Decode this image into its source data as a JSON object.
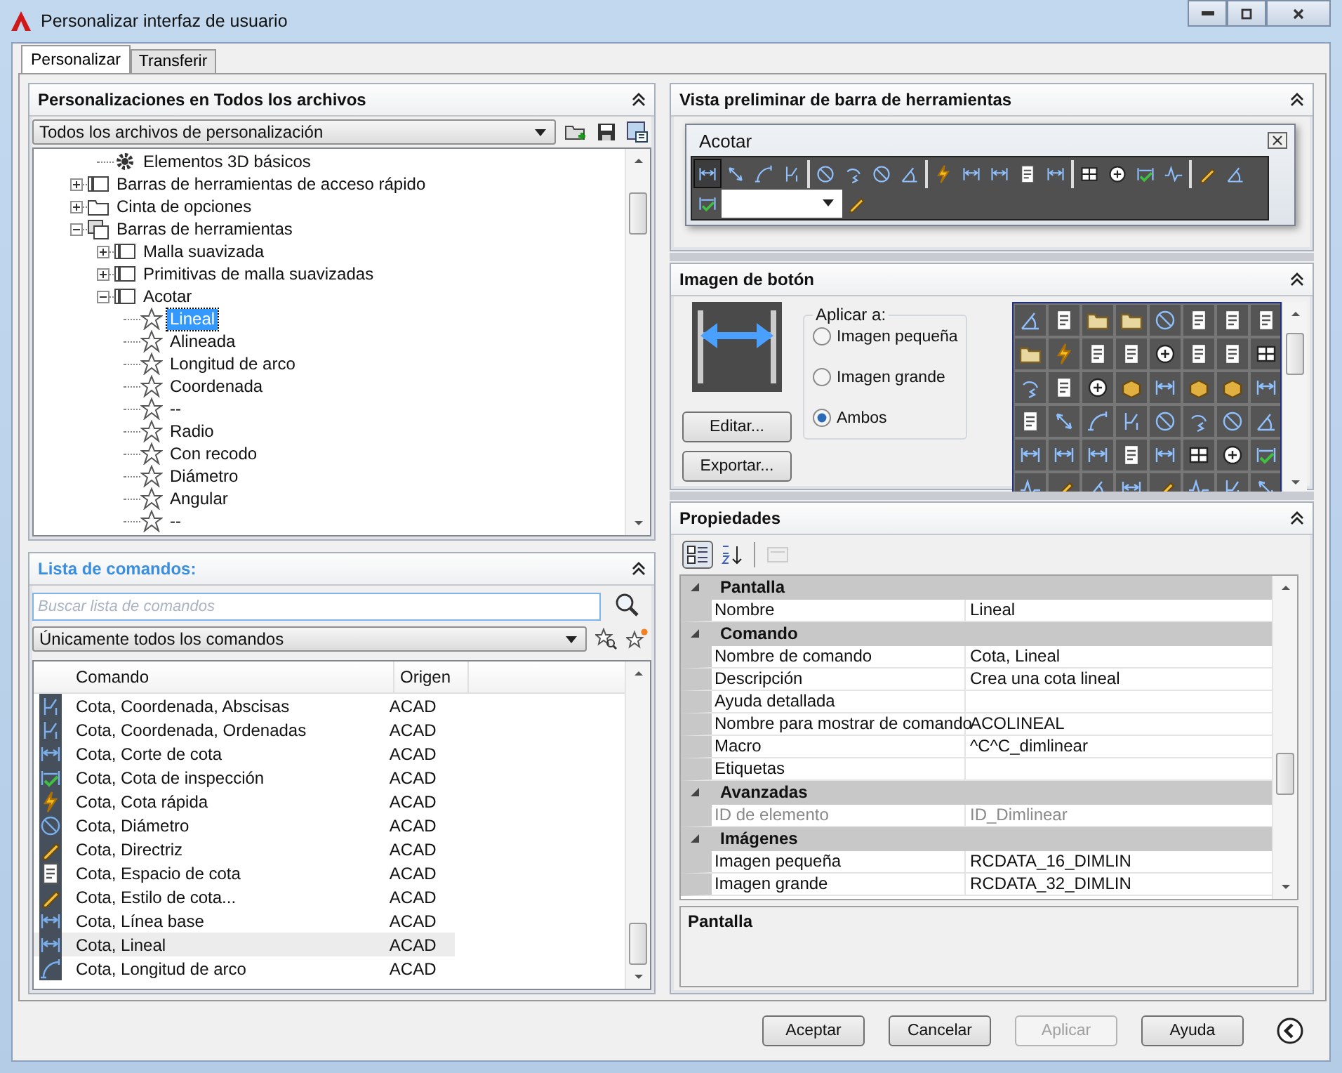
{
  "window": {
    "title": "Personalizar interfaz de usuario"
  },
  "tabs": [
    {
      "label": "Personalizar",
      "selected": true
    },
    {
      "label": "Transferir",
      "selected": false
    }
  ],
  "customizations": {
    "title": "Personalizaciones en Todos los archivos",
    "file_select": "Todos los archivos de personalización",
    "tree": [
      {
        "children": [
          {
            "label": "Elementos 3D básicos",
            "kind": "element",
            "selected": false
          }
        ]
      },
      {
        "label": "Barras de herramientas de acceso rápido",
        "kind": "quick-access",
        "expanded": false,
        "selected": false
      },
      {
        "label": "Cinta de opciones",
        "kind": "ribbon",
        "expanded": false,
        "selected": false
      },
      {
        "label": "Barras de herramientas",
        "kind": "toolbar-group",
        "expanded": true,
        "selected": false,
        "children": [
          {
            "label": "Malla suavizada",
            "kind": "toolbar",
            "expanded": false,
            "selected": false
          },
          {
            "label": "Primitivas de malla suavizadas",
            "kind": "toolbar",
            "expanded": false,
            "selected": false
          },
          {
            "label": "Acotar",
            "kind": "toolbar",
            "expanded": true,
            "selected": false,
            "children": [
              {
                "label": "Lineal",
                "kind": "command",
                "selected": true
              },
              {
                "label": "Alineada",
                "kind": "command",
                "selected": false
              },
              {
                "label": "Longitud de arco",
                "kind": "command",
                "selected": false
              },
              {
                "label": "Coordenada",
                "kind": "command",
                "selected": false
              },
              {
                "label": "--",
                "kind": "command",
                "selected": false
              },
              {
                "label": "Radio",
                "kind": "command",
                "selected": false
              },
              {
                "label": "Con recodo",
                "kind": "command",
                "selected": false
              },
              {
                "label": "Diámetro",
                "kind": "command",
                "selected": false
              },
              {
                "label": "Angular",
                "kind": "command",
                "selected": false
              },
              {
                "label": "--",
                "kind": "command",
                "selected": false
              }
            ]
          }
        ]
      }
    ]
  },
  "command_list": {
    "title": "Lista de comandos:",
    "search": {
      "placeholder": "Buscar lista de comandos"
    },
    "filter": "Únicamente todos los comandos",
    "columns": [
      "Comando",
      "Origen"
    ],
    "rows": [
      {
        "name": "Cota, Coordenada, Abscisas",
        "source": "ACAD",
        "selected": false
      },
      {
        "name": "Cota, Coordenada, Ordenadas",
        "source": "ACAD",
        "selected": false
      },
      {
        "name": "Cota, Corte de cota",
        "source": "ACAD",
        "selected": false
      },
      {
        "name": "Cota, Cota de inspección",
        "source": "ACAD",
        "selected": false
      },
      {
        "name": "Cota, Cota rápida",
        "source": "ACAD",
        "selected": false
      },
      {
        "name": "Cota, Diámetro",
        "source": "ACAD",
        "selected": false
      },
      {
        "name": "Cota, Directriz",
        "source": "ACAD",
        "selected": false
      },
      {
        "name": "Cota, Espacio de cota",
        "source": "ACAD",
        "selected": false
      },
      {
        "name": "Cota, Estilo de cota...",
        "source": "ACAD",
        "selected": false
      },
      {
        "name": "Cota, Línea base",
        "source": "ACAD",
        "selected": false
      },
      {
        "name": "Cota, Lineal",
        "source": "ACAD",
        "selected": true
      },
      {
        "name": "Cota, Longitud de arco",
        "source": "ACAD",
        "selected": false
      }
    ]
  },
  "toolbar_preview": {
    "title": "Vista preliminar de barra de herramientas",
    "toolbar_title": "Acotar",
    "tools": [
      {
        "selected": true
      },
      {
        "selected": false
      },
      {
        "selected": false
      },
      {
        "selected": false
      },
      {
        "selected": false
      },
      {
        "selected": false
      },
      {
        "selected": false
      },
      {
        "selected": false
      },
      {
        "selected": false
      },
      {
        "selected": false
      },
      {
        "selected": false
      },
      {
        "selected": false
      },
      {
        "selected": false
      },
      {
        "selected": false
      },
      {
        "selected": false
      },
      {
        "selected": false
      },
      {
        "selected": false
      },
      {
        "selected": false
      },
      {
        "selected": false
      },
      {
        "selected": false
      },
      {
        "selected": false
      }
    ]
  },
  "button_image": {
    "title": "Imagen de botón",
    "apply_label": "Aplicar a:",
    "options": [
      {
        "label": "Imagen pequeña",
        "selected": false
      },
      {
        "label": "Imagen grande",
        "selected": false
      },
      {
        "label": "Ambos",
        "selected": true
      }
    ],
    "buttons": [
      "Editar...",
      "Exportar..."
    ]
  },
  "properties": {
    "title": "Propiedades",
    "view_buttons": [
      {
        "selected": true,
        "disabled": false
      },
      {
        "selected": false,
        "disabled": false
      },
      {
        "selected": false,
        "disabled": true
      }
    ],
    "categories": [
      {
        "name": "Pantalla",
        "expanded": true,
        "rows": [
          {
            "name": "Nombre",
            "value": "Lineal",
            "disabled": false
          }
        ]
      },
      {
        "name": "Comando",
        "expanded": true,
        "rows": [
          {
            "name": "Nombre de comando",
            "value": "Cota, Lineal",
            "disabled": false
          },
          {
            "name": "Descripción",
            "value": "Crea una cota lineal",
            "disabled": false
          },
          {
            "name": "Ayuda detallada",
            "disabled": false
          },
          {
            "name": "Nombre para mostrar de comando",
            "value": "ACOLINEAL",
            "disabled": false
          },
          {
            "name": "Macro",
            "value": "^C^C_dimlinear",
            "disabled": false
          },
          {
            "name": "Etiquetas",
            "disabled": false
          }
        ]
      },
      {
        "name": "Avanzadas",
        "expanded": true,
        "rows": [
          {
            "name": "ID de elemento",
            "value": "ID_Dimlinear",
            "disabled": true
          }
        ]
      },
      {
        "name": "Imágenes",
        "expanded": true,
        "rows": [
          {
            "name": "Imagen pequeña",
            "value": "RCDATA_16_DIMLIN",
            "disabled": false
          },
          {
            "name": "Imagen grande",
            "value": "RCDATA_32_DIMLIN",
            "disabled": false
          }
        ]
      }
    ],
    "description_title": "Pantalla"
  },
  "buttons": [
    {
      "label": "Aceptar",
      "disabled": false
    },
    {
      "label": "Cancelar",
      "disabled": false
    },
    {
      "label": "Aplicar",
      "disabled": true
    },
    {
      "label": "Ayuda",
      "disabled": false
    }
  ]
}
